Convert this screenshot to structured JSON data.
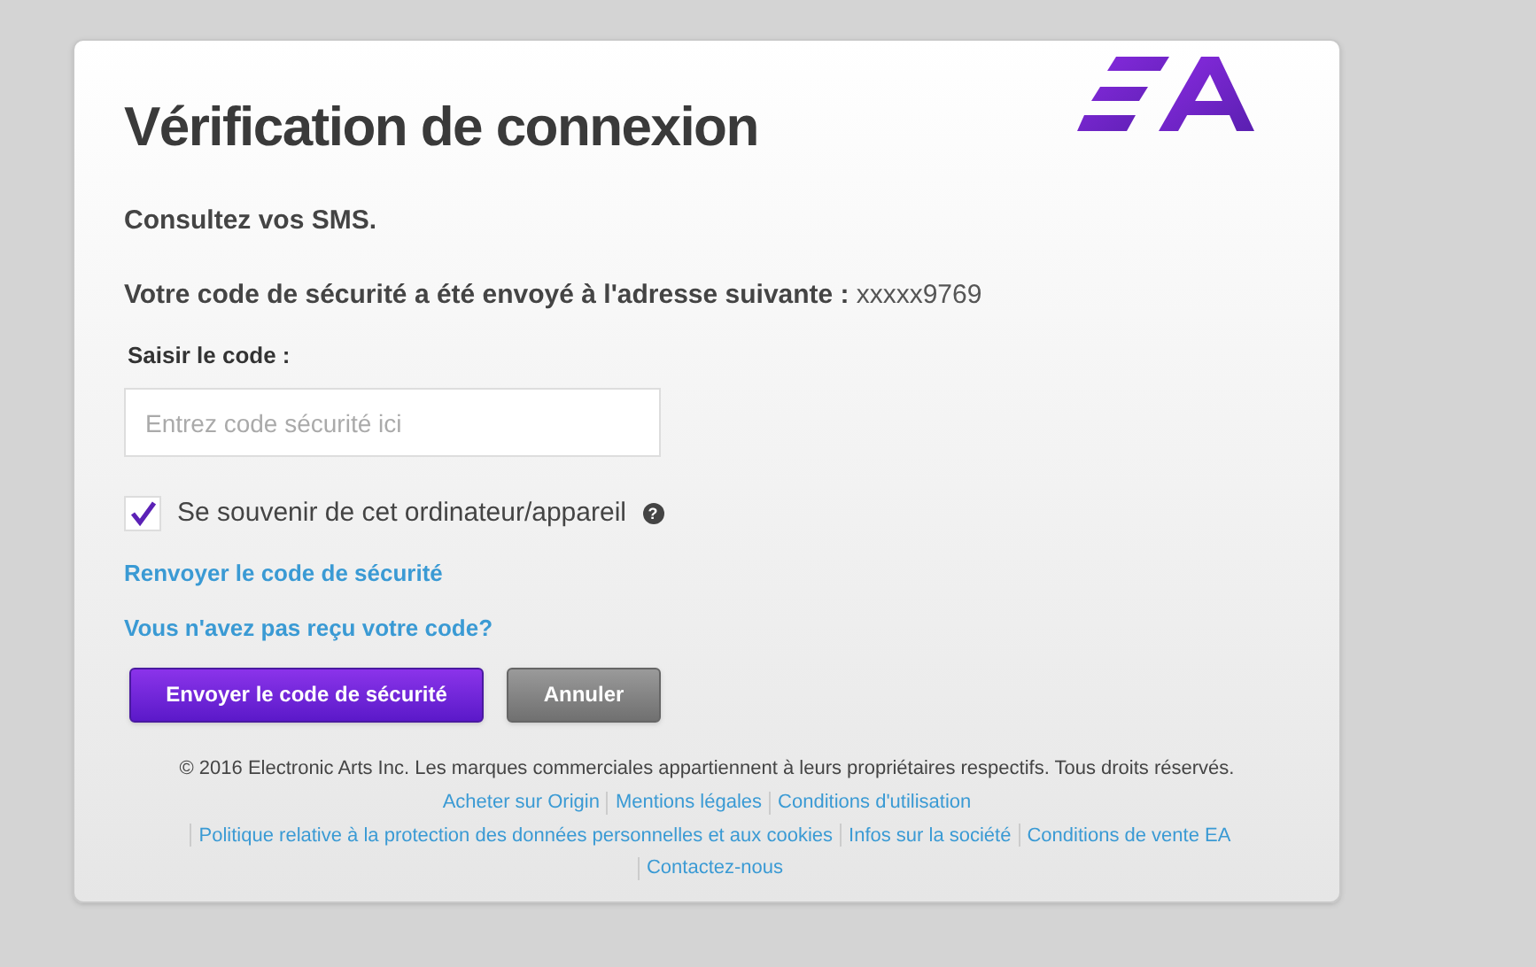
{
  "title": "Vérification de connexion",
  "instruction": "Consultez vos SMS.",
  "sent_message": {
    "label": "Votre code de sécurité a été envoyé à l'adresse suivante :",
    "value": "xxxxx9769"
  },
  "code_field": {
    "label": "Saisir le code :",
    "placeholder": "Entrez code sécurité ici"
  },
  "remember": {
    "label": "Se souvenir de cet ordinateur/appareil",
    "checked": true,
    "help": "?"
  },
  "links": [
    "Renvoyer le code de sécurité",
    "Vous n'avez pas reçu votre code?"
  ],
  "buttons": [
    {
      "label": "Envoyer le code de sécurité",
      "kind": "primary"
    },
    {
      "label": "Annuler",
      "kind": "secondary"
    }
  ],
  "footer": {
    "copyright": "© 2016 Electronic Arts Inc. Les marques commerciales appartiennent à leurs propriétaires respectifs. Tous droits réservés.",
    "link_rows": [
      [
        "Acheter sur Origin",
        "Mentions légales",
        "Conditions d'utilisation"
      ],
      [
        "Politique relative à la protection des données personnelles et aux cookies",
        "Infos sur la société",
        "Conditions de vente EA"
      ],
      [
        "Contactez-nous"
      ]
    ]
  }
}
